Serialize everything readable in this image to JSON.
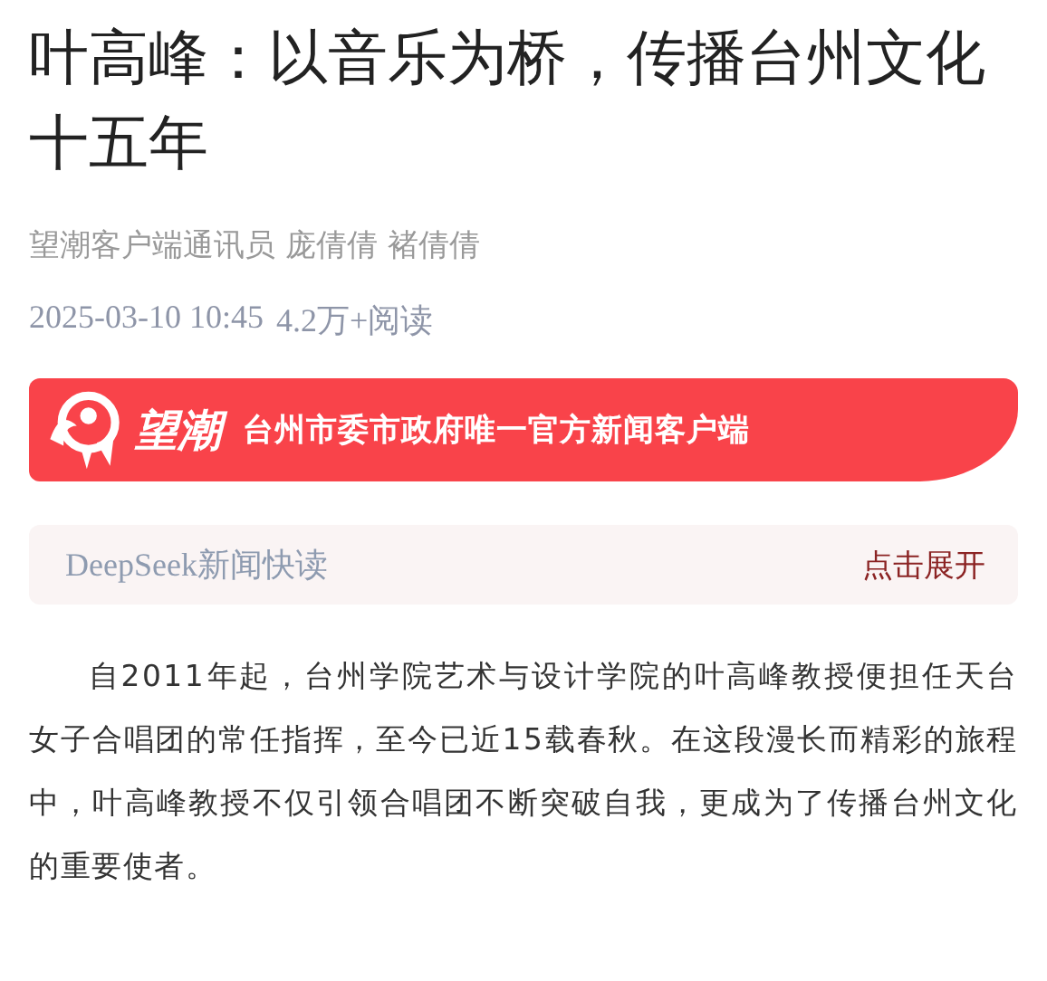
{
  "article": {
    "title": "叶高峰：以音乐为桥，传播台州文化十五年",
    "byline": "望潮客户端通讯员 庞倩倩 褚倩倩",
    "datetime": "2025-03-10 10:45",
    "reads": "4.2万+阅读"
  },
  "banner": {
    "logo_text": "望潮",
    "slogan": "台州市委市政府唯一官方新闻客户端"
  },
  "quick_read": {
    "label": "DeepSeek新闻快读",
    "action": "点击展开"
  },
  "paragraphs": [
    "自2011年起，台州学院艺术与设计学院的叶高峰教授便担任天台女子合唱团的常任指挥，至今已近15载春秋。在这段漫长而精彩的旅程中，叶高峰教授不仅引领合唱团不断突破自我，更成为了传播台州文化的重要使者。"
  ]
}
